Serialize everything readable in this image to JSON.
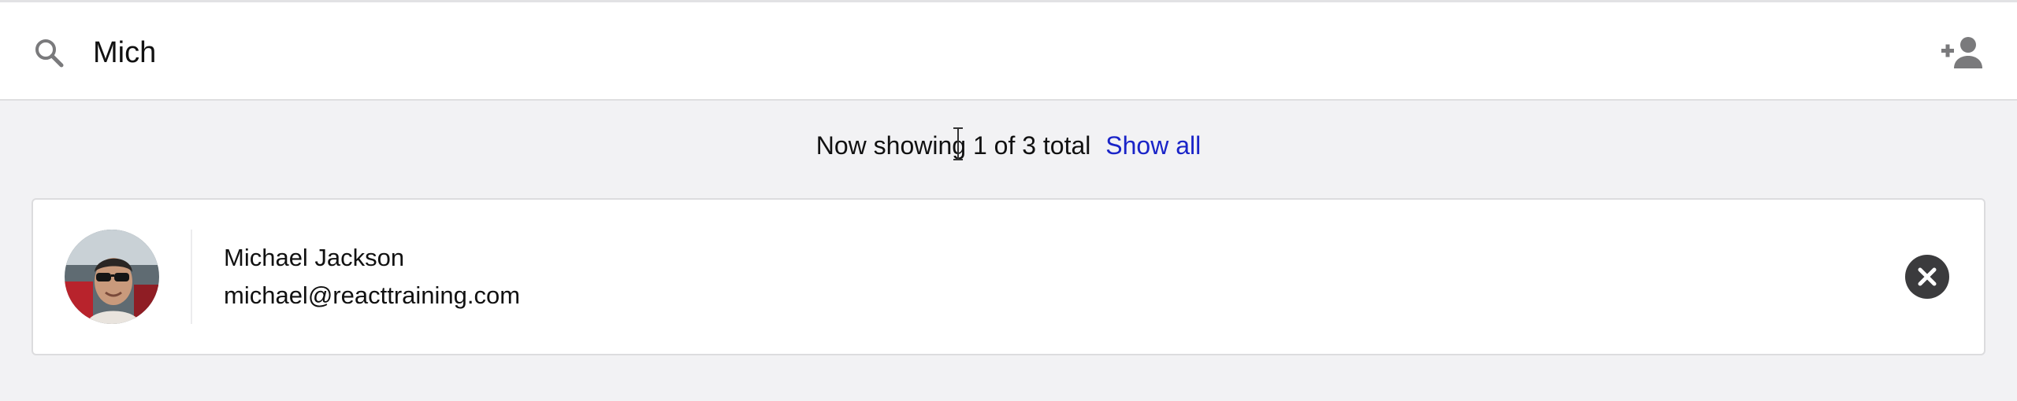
{
  "search": {
    "value": "Mich",
    "icon": "search-icon"
  },
  "header": {
    "add_contact_icon": "add-person-icon"
  },
  "status": {
    "text": "Now showing 1 of 3 total",
    "show_all_label": "Show all",
    "link_color": "#1a24c8"
  },
  "contacts": [
    {
      "name": "Michael Jackson",
      "email": "michael@reacttraining.com",
      "avatar": "avatar-photo",
      "remove_icon": "close-icon"
    }
  ],
  "colors": {
    "background": "#f2f2f4",
    "card": "#ffffff",
    "remove_button": "#3b3b3d"
  }
}
